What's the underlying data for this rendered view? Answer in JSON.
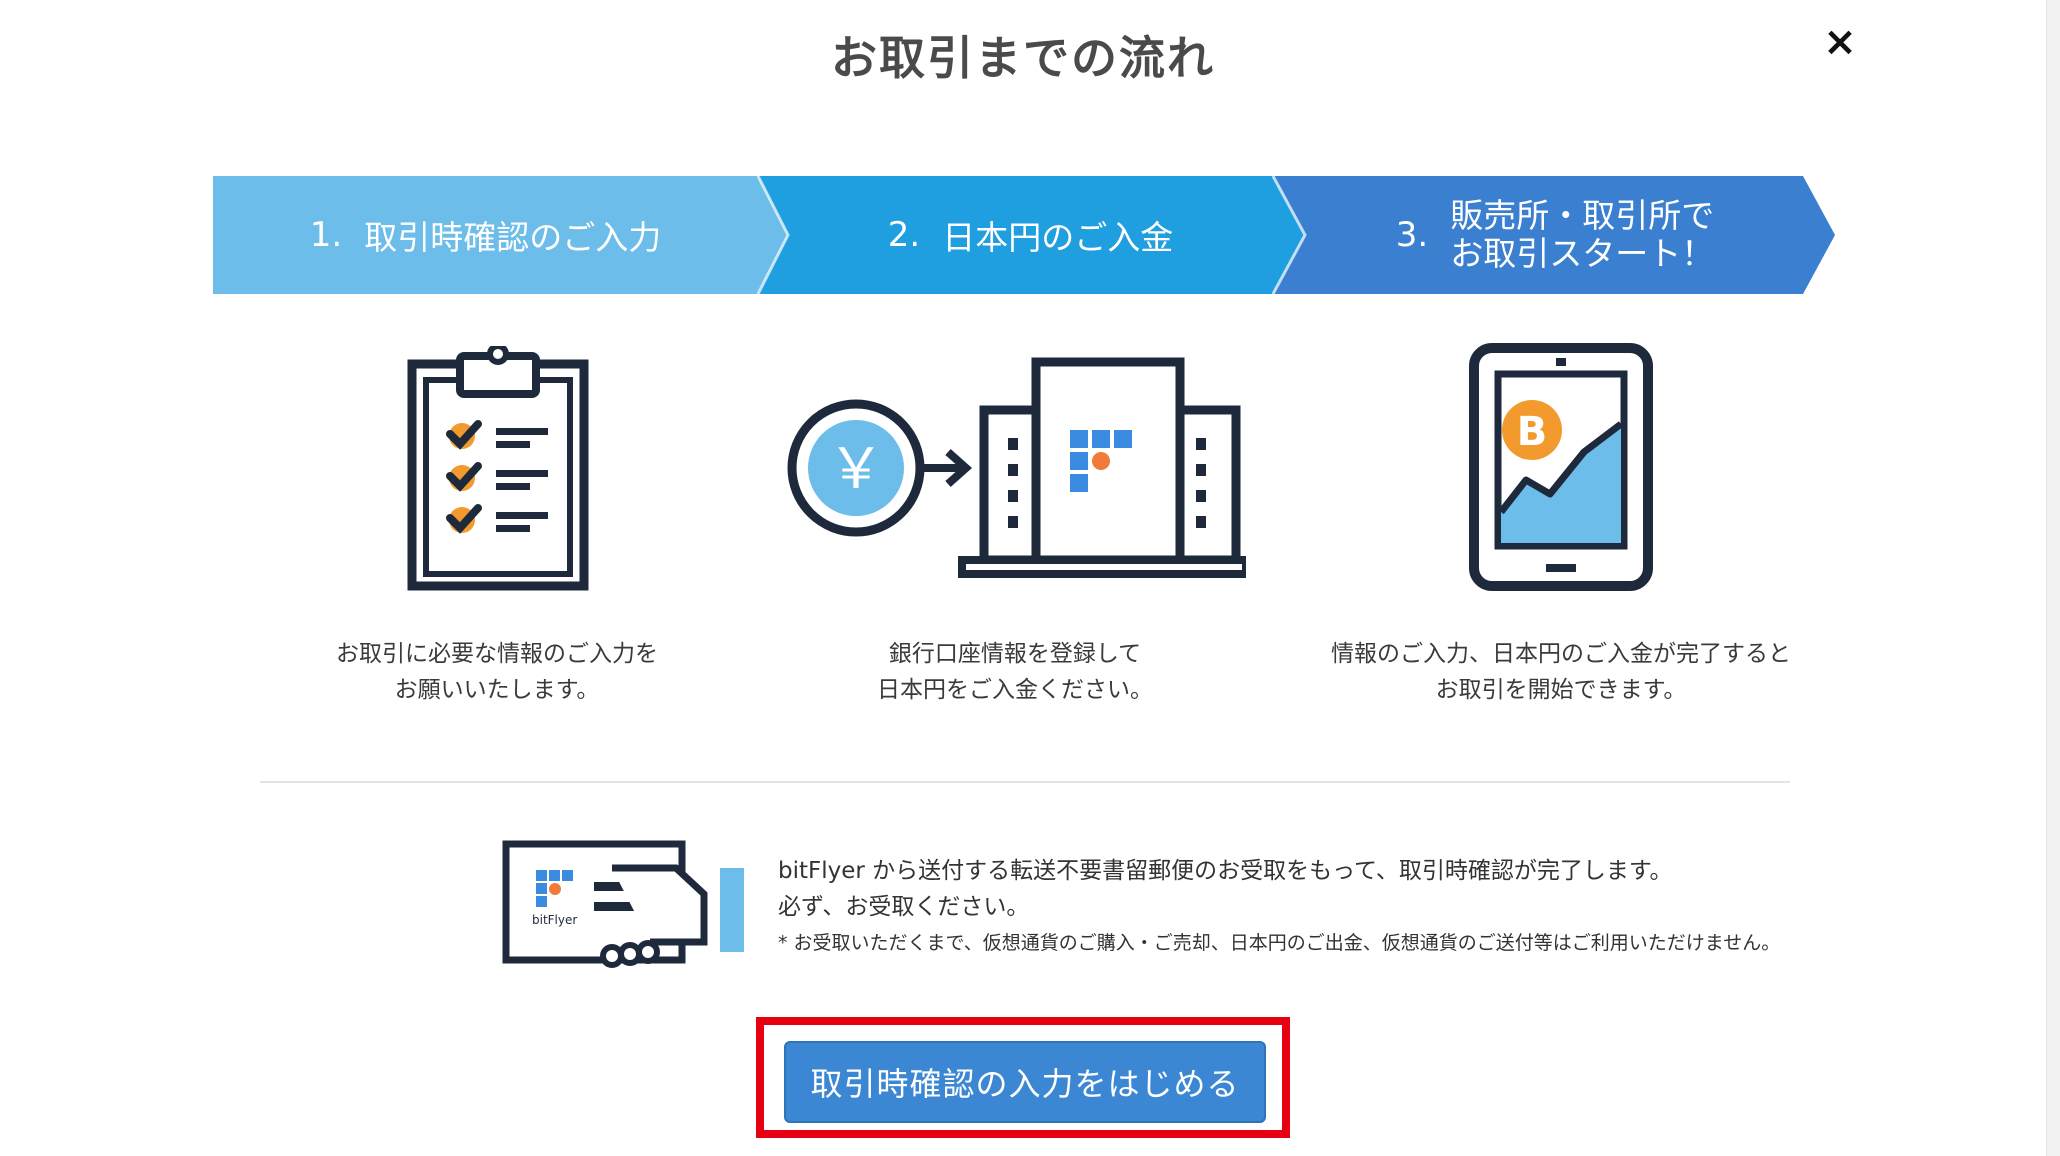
{
  "modal": {
    "title": "お取引までの流れ",
    "close_label": "×"
  },
  "steps": [
    {
      "number": "1.",
      "label": "取引時確認のご入力",
      "color": "#6dbdea"
    },
    {
      "number": "2.",
      "label": "日本円のご入金",
      "color": "#1f9ee0"
    },
    {
      "number": "3.",
      "label_line1": "販売所・取引所で",
      "label_line2": "お取引スタート！",
      "color": "#3a7fd0"
    }
  ],
  "descriptions": [
    {
      "line1": "お取引に必要な情報のご入力を",
      "line2": "お願いいたします。"
    },
    {
      "line1": "銀行口座情報を登録して",
      "line2": "日本円をご入金ください。"
    },
    {
      "line1": "情報のご入力、日本円のご入金が完了すると",
      "line2": "お取引を開始できます。"
    }
  ],
  "illustrations": {
    "yen_symbol": "￥",
    "bitcoin_symbol": "B",
    "card_brand": "bitFlyer"
  },
  "notice": {
    "line1": "bitFlyer から送付する転送不要書留郵便のお受取をもって、取引時確認が完了します。",
    "line2": "必ず、お受取ください。",
    "footnote": "* お受取いただくまで、仮想通貨のご購入・ご売却、日本円のご出金、仮想通貨のご送付等はご利用いただけません。"
  },
  "cta": {
    "label": "取引時確認の入力をはじめる"
  },
  "colors": {
    "navy": "#1e2a3c",
    "orange": "#f29a2e",
    "light_blue": "#6dbdea",
    "mid_blue": "#1f9ee0",
    "dark_blue": "#3a7fd0",
    "brand_blue": "#3b8be0",
    "highlight_red": "#e60012"
  }
}
